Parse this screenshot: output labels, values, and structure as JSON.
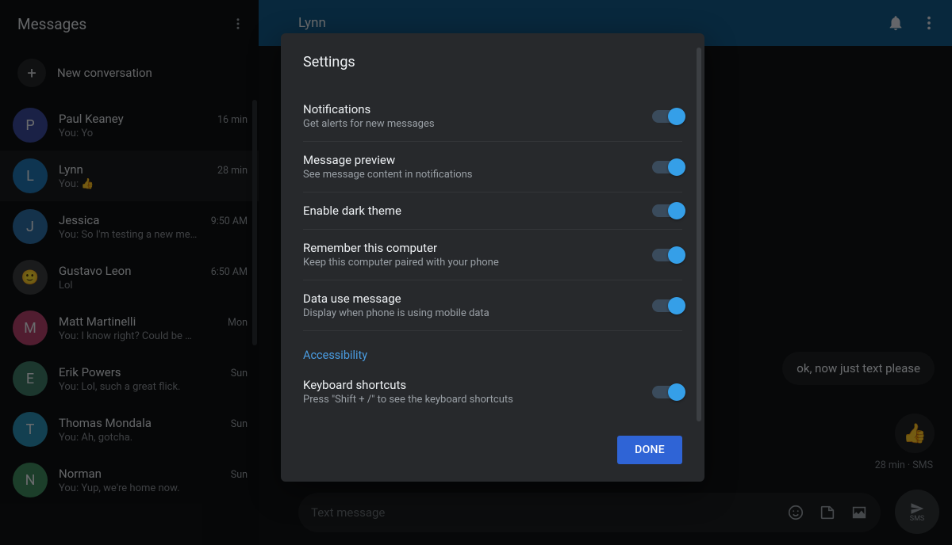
{
  "sidebar": {
    "title": "Messages",
    "new_conversation": "New conversation",
    "conversations": [
      {
        "initial": "P",
        "color": "#3b4a9c",
        "name": "Paul Keaney",
        "time": "16 min",
        "preview": "You: Yo"
      },
      {
        "initial": "L",
        "color": "#2077b3",
        "name": "Lynn",
        "time": "28 min",
        "preview": "You: 👍"
      },
      {
        "initial": "J",
        "color": "#2e6fa7",
        "name": "Jessica",
        "time": "9:50 AM",
        "preview": "You: So I'm testing a new me…"
      },
      {
        "initial": "",
        "color": "#3b3c3e",
        "name": "Gustavo Leon",
        "time": "6:50 AM",
        "preview": "Lol"
      },
      {
        "initial": "M",
        "color": "#b3416a",
        "name": "Matt Martinelli",
        "time": "Mon",
        "preview": "You: I know right? Could be …"
      },
      {
        "initial": "E",
        "color": "#3e7a67",
        "name": "Erik Powers",
        "time": "Sun",
        "preview": "You: Lol, such a great flick."
      },
      {
        "initial": "T",
        "color": "#2a8fb3",
        "name": "Thomas Mondala",
        "time": "Sun",
        "preview": "You: Ah, gotcha."
      },
      {
        "initial": "N",
        "color": "#3e8a5e",
        "name": "Norman",
        "time": "Sun",
        "preview": "You: Yup, we're home now."
      }
    ],
    "active_index": 1
  },
  "header": {
    "title": "Lynn"
  },
  "conversation": {
    "last_bubble": "ok, now just text please",
    "thumb": "👍",
    "meta": "28 min · SMS"
  },
  "compose": {
    "placeholder": "Text message",
    "send_label": "SMS"
  },
  "dialog": {
    "title": "Settings",
    "rows": [
      {
        "title": "Notifications",
        "sub": "Get alerts for new messages"
      },
      {
        "title": "Message preview",
        "sub": "See message content in notifications"
      },
      {
        "title": "Enable dark theme",
        "sub": ""
      },
      {
        "title": "Remember this computer",
        "sub": "Keep this computer paired with your phone"
      },
      {
        "title": "Data use message",
        "sub": "Display when phone is using mobile data"
      }
    ],
    "accessibility_label": "Accessibility",
    "keyboard": {
      "title": "Keyboard shortcuts",
      "sub": "Press \"Shift + /\" to see the keyboard shortcuts"
    },
    "done_label": "DONE"
  }
}
